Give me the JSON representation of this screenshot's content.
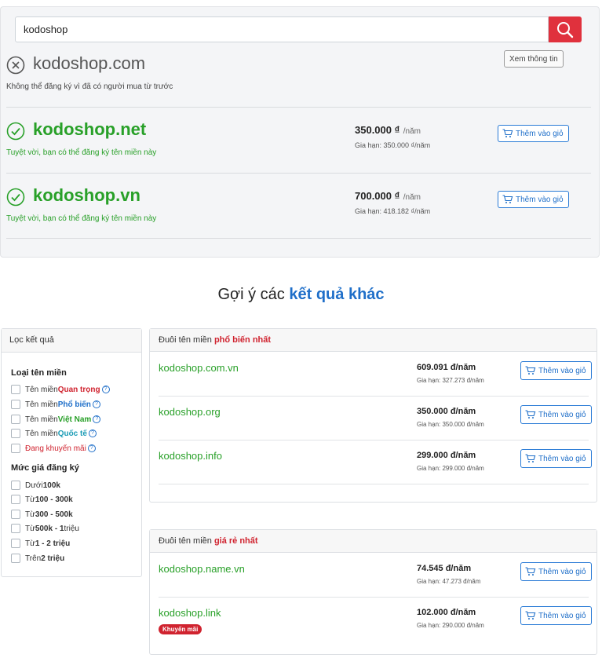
{
  "search": {
    "value": "kodoshop"
  },
  "info_button": "Xem thông tin",
  "results": [
    {
      "domain": "kodoshop.com",
      "status": "taken",
      "message": "Không thể đăng ký vì đã có người mua từ trước"
    },
    {
      "domain": "kodoshop.net",
      "status": "available",
      "message": "Tuyệt vời, bạn có thể đăng ký tên miền này",
      "price": "350.000 ₫",
      "per": "/năm",
      "renew": "Gia hạn: 350.000 ₫/năm",
      "cart_label": "Thêm vào giỏ"
    },
    {
      "domain": "kodoshop.vn",
      "status": "available",
      "message": "Tuyệt vời, bạn có thể đăng ký tên miền này",
      "price": "700.000 ₫",
      "per": "/năm",
      "renew": "Gia hạn: 418.182 ₫/năm",
      "cart_label": "Thêm vào giỏ"
    }
  ],
  "suggest": {
    "title_plain": "Gợi ý các ",
    "title_accent": "kết quả khác"
  },
  "filter": {
    "header": "Lọc kết quả",
    "type_title": "Loại tên miền",
    "type_items": [
      {
        "prefix": "Tên miền ",
        "highlight": "Quan trọng"
      },
      {
        "prefix": "Tên miền ",
        "highlight": "Phổ biến"
      },
      {
        "prefix": "Tên miền ",
        "highlight": "Việt Nam"
      },
      {
        "prefix": "Tên miền ",
        "highlight": "Quốc tế"
      },
      {
        "prefix": "",
        "highlight": "Đang khuyến mãi"
      }
    ],
    "price_title": "Mức giá đăng ký",
    "price_items": [
      {
        "a": "Dưới ",
        "b": "100k",
        "c": ""
      },
      {
        "a": "Từ ",
        "b": "100 - 300k",
        "c": ""
      },
      {
        "a": "Từ ",
        "b": "300 - 500k",
        "c": ""
      },
      {
        "a": "Từ ",
        "b": "500k - 1",
        "c": " triệu"
      },
      {
        "a": "Từ ",
        "b": "1 - 2 triệu",
        "c": ""
      },
      {
        "a": "Trên ",
        "b": "2 triệu",
        "c": ""
      }
    ]
  },
  "popular": {
    "header_plain": "Đuôi tên miền ",
    "header_accent": "phổ biến nhất",
    "rows": [
      {
        "domain": "kodoshop.com.vn",
        "price": "609.091 đ/năm",
        "renew": "Gia hạn: 327.273 đ/năm",
        "cart_label": "Thêm vào giỏ"
      },
      {
        "domain": "kodoshop.org",
        "price": "350.000 đ/năm",
        "renew": "Gia hạn: 350.000 đ/năm",
        "cart_label": "Thêm vào giỏ"
      },
      {
        "domain": "kodoshop.info",
        "price": "299.000 đ/năm",
        "renew": "Gia hạn: 299.000 đ/năm",
        "cart_label": "Thêm vào giỏ"
      }
    ]
  },
  "cheap": {
    "header_plain": "Đuôi tên miền ",
    "header_accent": "giá rẻ nhất",
    "rows": [
      {
        "domain": "kodoshop.name.vn",
        "price": "74.545 đ/năm",
        "renew": "Gia hạn: 47.273 đ/năm",
        "cart_label": "Thêm vào giỏ"
      },
      {
        "domain": "kodoshop.link",
        "price": "102.000 đ/năm",
        "renew": "Gia hạn: 290.000 đ/năm",
        "cart_label": "Thêm vào giỏ",
        "badge": "Khuyến mãi"
      }
    ]
  },
  "colors": {
    "available": "#28a028",
    "accent_blue": "#1f6fc9",
    "accent_red": "#d0232f",
    "search_button": "#e0313d"
  }
}
